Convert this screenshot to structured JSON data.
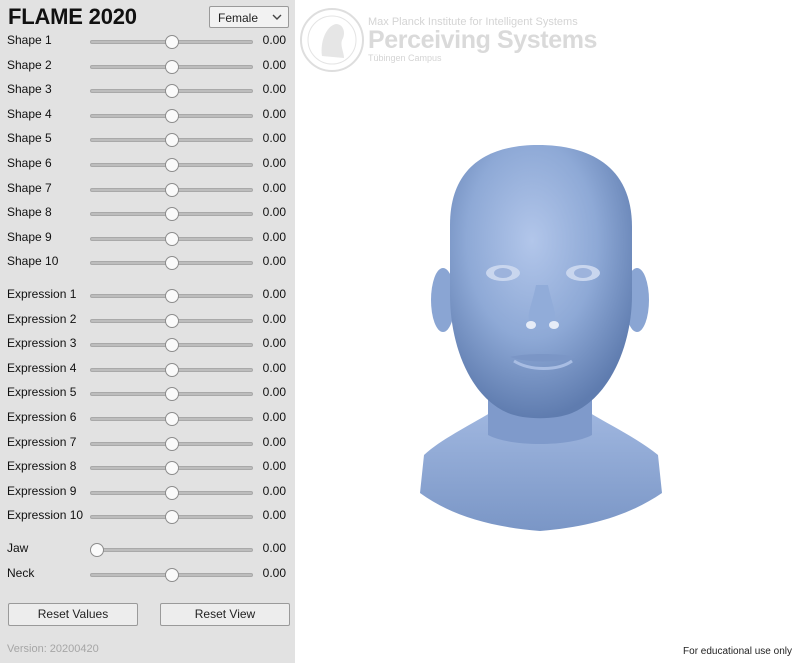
{
  "app": {
    "title": "FLAME 2020",
    "gender_selected": "Female",
    "version": "Version: 20200420"
  },
  "sliders": [
    {
      "label": "Shape 1",
      "value": "0.00",
      "level": 0.5
    },
    {
      "label": "Shape 2",
      "value": "0.00",
      "level": 0.5
    },
    {
      "label": "Shape 3",
      "value": "0.00",
      "level": 0.5
    },
    {
      "label": "Shape 4",
      "value": "0.00",
      "level": 0.5
    },
    {
      "label": "Shape 5",
      "value": "0.00",
      "level": 0.5
    },
    {
      "label": "Shape 6",
      "value": "0.00",
      "level": 0.5
    },
    {
      "label": "Shape 7",
      "value": "0.00",
      "level": 0.5
    },
    {
      "label": "Shape 8",
      "value": "0.00",
      "level": 0.5
    },
    {
      "label": "Shape 9",
      "value": "0.00",
      "level": 0.5
    },
    {
      "label": "Shape 10",
      "value": "0.00",
      "level": 0.5
    },
    {
      "label": "Expression 1",
      "value": "0.00",
      "level": 0.5
    },
    {
      "label": "Expression 2",
      "value": "0.00",
      "level": 0.5
    },
    {
      "label": "Expression 3",
      "value": "0.00",
      "level": 0.5
    },
    {
      "label": "Expression 4",
      "value": "0.00",
      "level": 0.5
    },
    {
      "label": "Expression 5",
      "value": "0.00",
      "level": 0.5
    },
    {
      "label": "Expression 6",
      "value": "0.00",
      "level": 0.5
    },
    {
      "label": "Expression 7",
      "value": "0.00",
      "level": 0.5
    },
    {
      "label": "Expression 8",
      "value": "0.00",
      "level": 0.5
    },
    {
      "label": "Expression 9",
      "value": "0.00",
      "level": 0.5
    },
    {
      "label": "Expression 10",
      "value": "0.00",
      "level": 0.5
    },
    {
      "label": "Jaw",
      "value": "0.00",
      "level": 0.0
    },
    {
      "label": "Neck",
      "value": "0.00",
      "level": 0.5
    }
  ],
  "buttons": {
    "reset_values": "Reset Values",
    "reset_view": "Reset View"
  },
  "branding": {
    "institute": "Max Planck Institute for Intelligent Systems",
    "department": "Perceiving Systems",
    "campus": "Tübingen Campus"
  },
  "footer": {
    "note": "For educational use only"
  },
  "icons": {
    "select_arrow": "chevron-down-icon",
    "logo": "minerva-seal-icon"
  },
  "colors": {
    "panel_bg": "#e2e2e2",
    "mesh_base": "#8ea9d6"
  }
}
